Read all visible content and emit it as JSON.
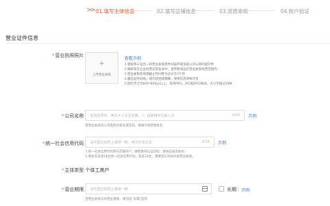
{
  "steps": [
    {
      "label": "01.填写主体信息"
    },
    {
      "label": "02.填写店铺信息"
    },
    {
      "label": "03.资质审核"
    },
    {
      "label": "04.账户验证"
    }
  ],
  "section": {
    "title": "营业证件信息"
  },
  "license_photo": {
    "label": "营业执照照片",
    "upload_label": "上传营业执照",
    "example_link": "查看示例",
    "notes": [
      "1.需提供三证合一的营业执照原件扫描件或加盖公司公章的复印件",
      "2.确保未在企业经营异常名录中，且所售商品在营业执照经营范围内",
      "3.营业执照有效期截止时间距今应大于3个月",
      "4.露出证件四角，请勿遮挡或模糊，保持信息清晰可见",
      "5.图片尺寸为800*800px以上，支持PNG、JPG和JPEG格式，大小不超过5MB"
    ]
  },
  "company_name": {
    "label": "公司名称",
    "placeholder": "包括括号体、英文大小写及空格、（）请使用中文输入法",
    "counter": "0/30",
    "example_link": "示例",
    "hint": "若营业执照的公司名称为星号或空白，请填写经营者姓名"
  },
  "credit_code": {
    "label": "统一社会信用代码",
    "placeholder": "请与营业执照上保持一致，英文字母大写",
    "counter": "0/18",
    "example_link": "示例",
    "hints": [
      "1.统一社会信用代码用于店铺开户，填错影响认证流程，请务必再次核对；",
      "2.目前仅支持18位统一社会信用代码，若非18位，需要到工商局升级营业执照。"
    ]
  },
  "entity_type": {
    "label": "主体类型",
    "value": "个体工商户"
  },
  "business_term": {
    "label": "营业期限",
    "placeholder": "请与营业执照上保持一致",
    "long_term_label": "长期",
    "example_link": "示例",
    "hint": "若营业执照没有营业期限，请勾选“长期”选项"
  },
  "colors": {
    "accent": "#e35a2c",
    "link": "#3a7bd5"
  },
  "icons": {
    "step_arrow": "double-chevron-right-icon",
    "calendar": "calendar-icon",
    "upload": "plus-icon"
  }
}
